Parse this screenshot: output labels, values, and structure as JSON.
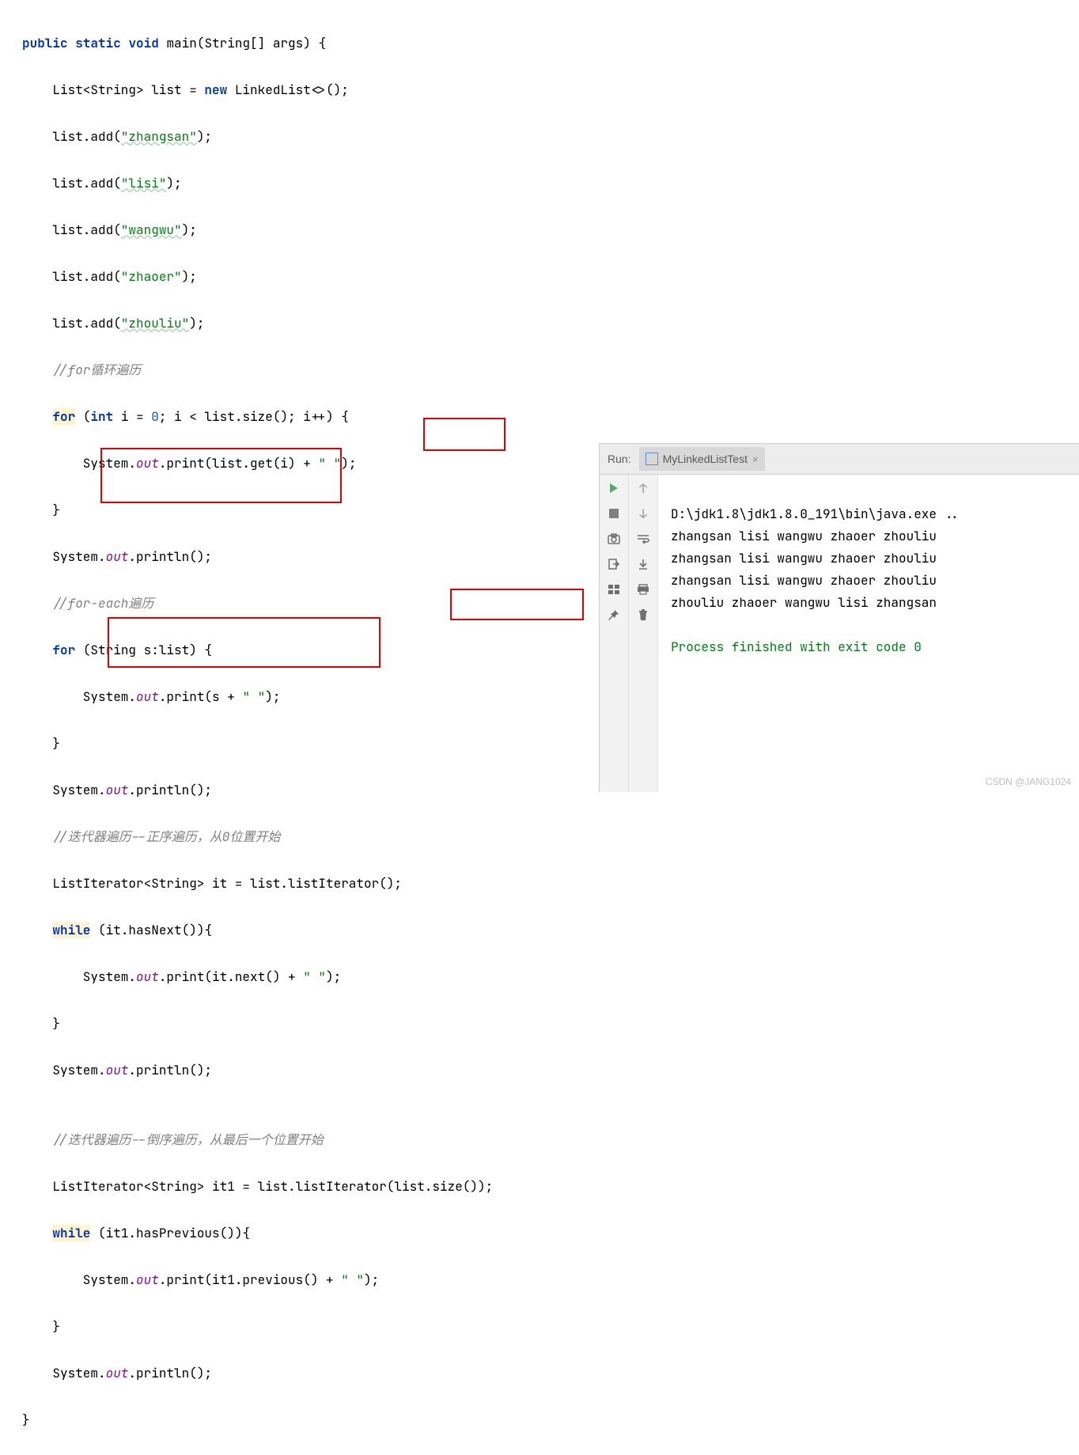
{
  "code": {
    "l1_kw_public": "public",
    "l1_kw_static": "static",
    "l1_kw_void": "void",
    "l1_main": "main(String[] args) {",
    "l2_a": "    List<String> list = ",
    "l2_kw_new": "new",
    "l2_b": " LinkedList<>();",
    "l3_a": "    list.add(",
    "l3_str": "\"zhangsan\"",
    "l3_b": ");",
    "l4_a": "    list.add(",
    "l4_str": "\"lisi\"",
    "l4_b": ");",
    "l5_a": "    list.add(",
    "l5_str": "\"wangwu\"",
    "l5_b": ");",
    "l6_a": "    list.add(",
    "l6_str": "\"zhaoer\"",
    "l6_b": ");",
    "l7_a": "    list.add(",
    "l7_str": "\"zhouliu\"",
    "l7_b": ");",
    "l8_cmt": "    //for循环遍历",
    "l9_pad": "    ",
    "l9_kw_for": "for",
    "l9_a": " (",
    "l9_kw_int": "int",
    "l9_b": " i = ",
    "l9_zero": "0",
    "l9_c": "; i < list.size(); i++) {",
    "l10_a": "        System.",
    "l10_out": "out",
    "l10_b": ".print(list.get(i) + ",
    "l10_sp": "\" \"",
    "l10_c": ");",
    "l11": "    }",
    "l12_a": "    System.",
    "l12_out": "out",
    "l12_b": ".println();",
    "l13_cmt": "    //for-each遍历",
    "l14_pad": "    ",
    "l14_kw_for": "for",
    "l14_a": " (String s:list) {",
    "l15_a": "        System.",
    "l15_out": "out",
    "l15_b": ".print(s + ",
    "l15_sp": "\" \"",
    "l15_c": ");",
    "l16": "    }",
    "l17_a": "    System.",
    "l17_out": "out",
    "l17_b": ".println();",
    "l18_cmt": "    //迭代器遍历--正序遍历，从0位置开始",
    "l19": "    ListIterator<String> it = list.listIterator();",
    "l20_pad": "    ",
    "l20_kw_while": "while",
    "l20_a": " (it.hasNext()){",
    "l21_a": "        System.",
    "l21_out": "out",
    "l21_b": ".print(it.next() + ",
    "l21_sp": "\" \"",
    "l21_c": ");",
    "l22": "    }",
    "l23_a": "    System.",
    "l23_out": "out",
    "l23_b": ".println();",
    "l24": "",
    "l25_cmt": "    //迭代器遍历--倒序遍历，从最后一个位置开始",
    "l26": "    ListIterator<String> it1 = list.listIterator(list.size());",
    "l27_pad": "    ",
    "l27_kw_while": "while",
    "l27_a": " (it1.hasPrevious()){",
    "l28_a": "        System.",
    "l28_out": "out",
    "l28_b": ".print(it1.previous() + ",
    "l28_sp": "\" \"",
    "l28_c": ");",
    "l29": "    }",
    "l30_a": "    System.",
    "l30_out": "out",
    "l30_b": ".println();",
    "l31": "}"
  },
  "run": {
    "label": "Run:",
    "tab": "MyLinkedListTest",
    "close": "×",
    "out_path": "D:\\jdk1.8\\jdk1.8.0_191\\bin\\java.exe ..",
    "out1": "zhangsan lisi wangwu zhaoer zhouliu",
    "out2": "zhangsan lisi wangwu zhaoer zhouliu",
    "out3": "zhangsan lisi wangwu zhaoer zhouliu",
    "out4": "zhouliu zhaoer wangwu lisi zhangsan",
    "exit": "Process finished with exit code 0"
  },
  "watermark": "CSDN @JANG1024"
}
